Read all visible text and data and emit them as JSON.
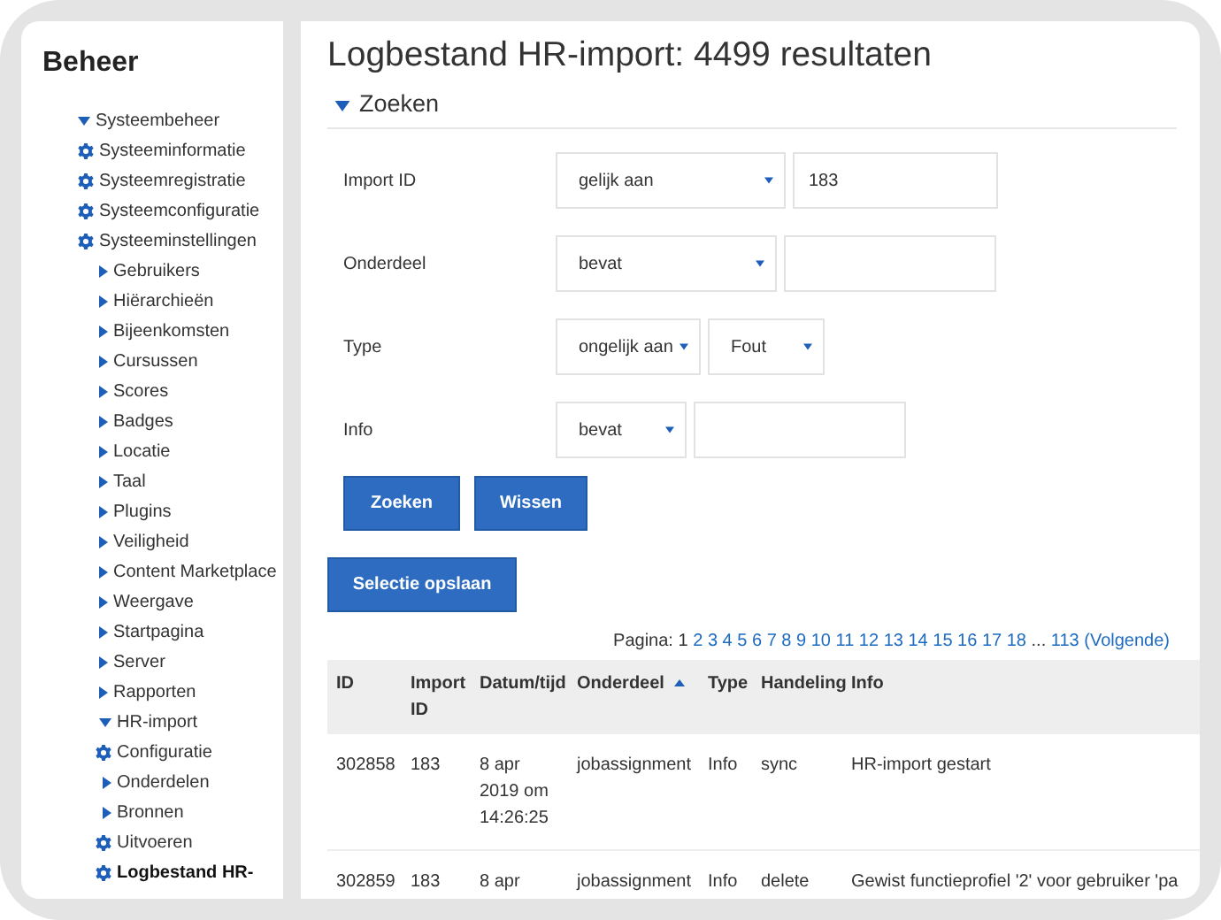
{
  "sidebar": {
    "title": "Beheer",
    "tree": [
      {
        "label": "Systeembeheer",
        "kind": "folder",
        "expanded": true,
        "selected": false,
        "children": [
          {
            "label": "Systeeminformatie",
            "kind": "leaf",
            "selected": false
          },
          {
            "label": "Systeemregistratie",
            "kind": "leaf",
            "selected": false
          },
          {
            "label": "Systeemconfiguratie",
            "kind": "leaf",
            "selected": false
          },
          {
            "label": "Systeeminstellingen",
            "kind": "leaf",
            "selected": false
          },
          {
            "label": "Gebruikers",
            "kind": "folder",
            "expanded": false,
            "selected": false
          },
          {
            "label": "Hiërarchieën",
            "kind": "folder",
            "expanded": false,
            "selected": false
          },
          {
            "label": "Bijeenkomsten",
            "kind": "folder",
            "expanded": false,
            "selected": false
          },
          {
            "label": "Cursussen",
            "kind": "folder",
            "expanded": false,
            "selected": false
          },
          {
            "label": "Scores",
            "kind": "folder",
            "expanded": false,
            "selected": false
          },
          {
            "label": "Badges",
            "kind": "folder",
            "expanded": false,
            "selected": false
          },
          {
            "label": "Locatie",
            "kind": "folder",
            "expanded": false,
            "selected": false
          },
          {
            "label": "Taal",
            "kind": "folder",
            "expanded": false,
            "selected": false
          },
          {
            "label": "Plugins",
            "kind": "folder",
            "expanded": false,
            "selected": false
          },
          {
            "label": "Veiligheid",
            "kind": "folder",
            "expanded": false,
            "selected": false
          },
          {
            "label": "Content Marketplace",
            "kind": "folder",
            "expanded": false,
            "selected": false
          },
          {
            "label": "Weergave",
            "kind": "folder",
            "expanded": false,
            "selected": false
          },
          {
            "label": "Startpagina",
            "kind": "folder",
            "expanded": false,
            "selected": false
          },
          {
            "label": "Server",
            "kind": "folder",
            "expanded": false,
            "selected": false
          },
          {
            "label": "Rapporten",
            "kind": "folder",
            "expanded": false,
            "selected": false
          },
          {
            "label": "HR-import",
            "kind": "folder",
            "expanded": true,
            "selected": false,
            "children": [
              {
                "label": "Configuratie",
                "kind": "leaf",
                "selected": false
              },
              {
                "label": "Onderdelen",
                "kind": "folder",
                "expanded": false,
                "selected": false
              },
              {
                "label": "Bronnen",
                "kind": "folder",
                "expanded": false,
                "selected": false
              },
              {
                "label": "Uitvoeren",
                "kind": "leaf",
                "selected": false
              },
              {
                "label": "Logbestand HR-",
                "kind": "leaf",
                "selected": true
              }
            ]
          }
        ]
      }
    ]
  },
  "page": {
    "title": "Logbestand HR-import: 4499 resultaten"
  },
  "search": {
    "heading": "Zoeken",
    "expanded": true,
    "filters": [
      {
        "label": "Import ID",
        "kind": "text",
        "operator": "gelijk aan",
        "value": "183"
      },
      {
        "label": "Onderdeel",
        "kind": "text",
        "operator": "bevat"
      },
      {
        "label": "Type",
        "kind": "select",
        "operator": "ongelijk aan",
        "value": "Fout"
      },
      {
        "label": "Info",
        "kind": "text",
        "operator": "bevat"
      }
    ],
    "buttons": [
      "Zoeken",
      "Wissen"
    ]
  },
  "save_button": "Selectie opslaan",
  "pagination": {
    "label": "Pagina:",
    "pages": [
      {
        "text": "1",
        "selected": true
      },
      {
        "text": "2",
        "selected": false
      },
      {
        "text": "3",
        "selected": false
      },
      {
        "text": "4",
        "selected": false
      },
      {
        "text": "5",
        "selected": false
      },
      {
        "text": "6",
        "selected": false
      },
      {
        "text": "7",
        "selected": false
      },
      {
        "text": "8",
        "selected": false
      },
      {
        "text": "9",
        "selected": false
      },
      {
        "text": "10",
        "selected": false
      },
      {
        "text": "11",
        "selected": false
      },
      {
        "text": "12",
        "selected": false
      },
      {
        "text": "13",
        "selected": false
      },
      {
        "text": "14",
        "selected": false
      },
      {
        "text": "15",
        "selected": false
      },
      {
        "text": "16",
        "selected": false
      },
      {
        "text": "17",
        "selected": false
      },
      {
        "text": "18",
        "selected": false
      }
    ],
    "ellipsis": "...",
    "last": "113",
    "next": "(Volgende)"
  },
  "table": {
    "columns": [
      {
        "label": "ID",
        "sorted": false
      },
      {
        "label": "Import ID",
        "sorted": false
      },
      {
        "label": "Datum/tijd",
        "sorted": false
      },
      {
        "label": "Onderdeel",
        "sorted": true
      },
      {
        "label": "Type",
        "sorted": false
      },
      {
        "label": "Handeling",
        "sorted": false
      },
      {
        "label": "Info",
        "sorted": false
      }
    ],
    "rows": [
      [
        "302858",
        "183",
        "8 apr 2019 om 14:26:25",
        "jobassignment",
        "Info",
        "sync",
        "HR-import gestart"
      ],
      [
        "302859",
        "183",
        "8 apr",
        "jobassignment",
        "Info",
        "delete",
        "Gewist functieprofiel '2' voor gebruiker 'pa"
      ]
    ]
  }
}
